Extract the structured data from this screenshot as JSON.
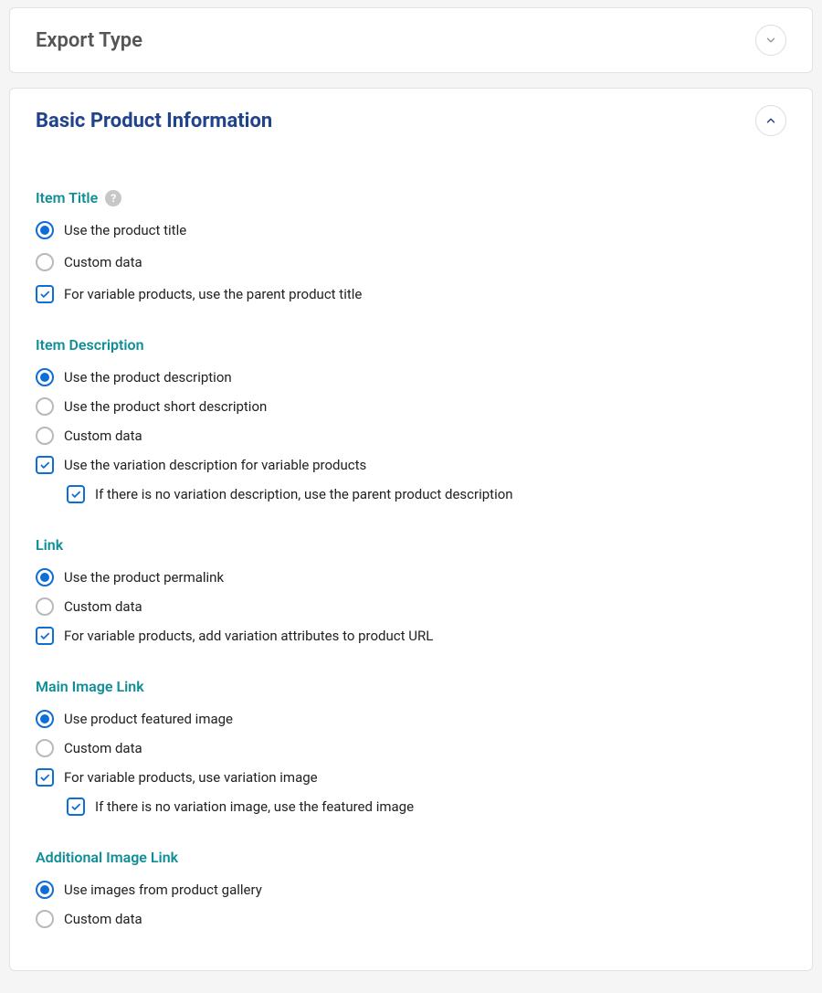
{
  "panels": {
    "exportType": {
      "title": "Export Type"
    },
    "basicProduct": {
      "title": "Basic Product Information"
    }
  },
  "sections": {
    "itemTitle": {
      "heading": "Item Title",
      "opts": {
        "useProductTitle": "Use the product title",
        "customData": "Custom data",
        "variableParent": "For variable products, use the parent product title"
      }
    },
    "itemDescription": {
      "heading": "Item Description",
      "opts": {
        "useProductDesc": "Use the product description",
        "useShortDesc": "Use the product short description",
        "customData": "Custom data",
        "useVariationDesc": "Use the variation description for variable products",
        "fallbackParent": "If there is no variation description, use the parent product description"
      }
    },
    "link": {
      "heading": "Link",
      "opts": {
        "permalink": "Use the product permalink",
        "customData": "Custom data",
        "addVariationAttrs": "For variable products, add variation attributes to product URL"
      }
    },
    "mainImage": {
      "heading": "Main Image Link",
      "opts": {
        "featured": "Use product featured image",
        "customData": "Custom data",
        "variationImage": "For variable products, use variation image",
        "fallbackFeatured": "If there is no variation image, use the featured image"
      }
    },
    "additionalImage": {
      "heading": "Additional Image Link",
      "opts": {
        "gallery": "Use images from product gallery",
        "customData": "Custom data"
      }
    }
  }
}
